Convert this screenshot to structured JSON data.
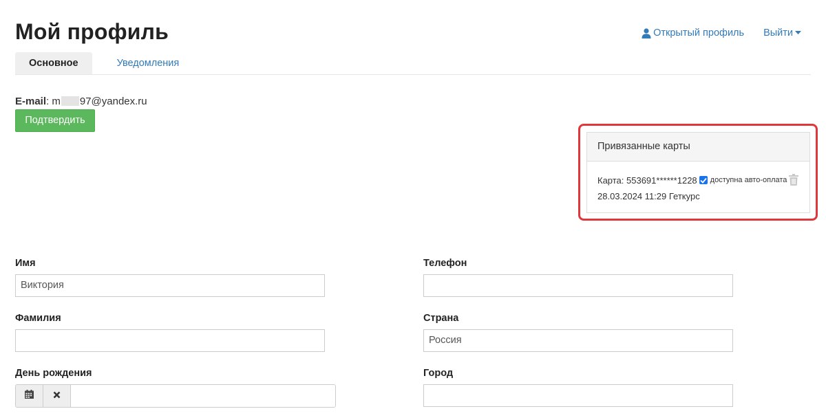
{
  "header": {
    "title": "Мой профиль",
    "public_profile_label": "Открытый профиль",
    "logout_label": "Выйти"
  },
  "tabs": [
    {
      "label": "Основное",
      "active": true
    },
    {
      "label": "Уведомления",
      "active": false
    }
  ],
  "email": {
    "label": "E-mail",
    "value_prefix": "m",
    "value_suffix": "97@yandex.ru",
    "confirm_label": "Подтвердить"
  },
  "cards": {
    "title": "Привязанные карты",
    "items": [
      {
        "card_label": "Карта: 553691******1228",
        "autopay_checked": true,
        "autopay_label": "доступна авто-оплата",
        "date_line": "28.03.2024 11:29 Геткурс"
      }
    ]
  },
  "form": {
    "first_name": {
      "label": "Имя",
      "value": "Виктория"
    },
    "last_name": {
      "label": "Фамилия",
      "value": ""
    },
    "birthday": {
      "label": "День рождения",
      "value": ""
    },
    "phone": {
      "label": "Телефон",
      "value": ""
    },
    "country": {
      "label": "Страна",
      "value": "Россия"
    },
    "city": {
      "label": "Город",
      "value": ""
    }
  },
  "colors": {
    "link": "#337ab7",
    "confirm_button": "#5cb85c",
    "highlight_border": "#e0373d",
    "checkbox": "#1a73e8"
  },
  "icons": [
    "user-icon",
    "caret-down-icon",
    "checkbox-checked-icon",
    "trash-icon",
    "calendar-icon",
    "close-icon"
  ]
}
